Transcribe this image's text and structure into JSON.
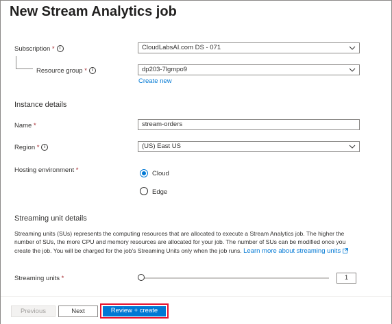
{
  "header": {
    "title": "New Stream Analytics job",
    "more": "···"
  },
  "project": {
    "subscription": {
      "label": "Subscription",
      "value": "CloudLabsAI.com DS - 071"
    },
    "resource_group": {
      "label": "Resource group",
      "value": "dp203-7lgmpo9",
      "create_new": "Create new"
    }
  },
  "instance": {
    "heading": "Instance details",
    "name": {
      "label": "Name",
      "value": "stream-orders"
    },
    "region": {
      "label": "Region",
      "value": "(US) East US"
    },
    "hosting": {
      "label": "Hosting environment",
      "options": [
        "Cloud",
        "Edge"
      ],
      "selected": "Cloud"
    }
  },
  "streaming": {
    "heading": "Streaming unit details",
    "description": "Streaming units (SUs) represents the computing resources that are allocated to execute a Stream Analytics job. The higher the number of SUs, the more CPU and memory resources are allocated for your job. The number of SUs can be modified once you create the job. You will be charged for the job's Streaming Units only when the job runs.",
    "learn_more": "Learn more about streaming units",
    "units_label": "Streaming units",
    "units_value": "1"
  },
  "footer": {
    "previous": "Previous",
    "next": "Next",
    "review": "Review + create"
  },
  "colors": {
    "accent": "#0078d4",
    "required": "#a4262c",
    "highlight": "#e8112d"
  }
}
